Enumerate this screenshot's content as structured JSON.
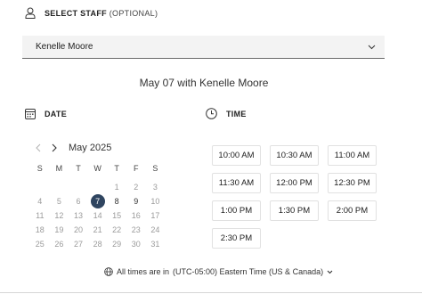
{
  "staff": {
    "label": "SELECT STAFF",
    "optional": "(OPTIONAL)",
    "selected": "Kenelle Moore"
  },
  "summary": "May 07 with Kenelle Moore",
  "date": {
    "label": "DATE",
    "month": "May 2025",
    "weekdays": [
      "S",
      "M",
      "T",
      "W",
      "T",
      "F",
      "S"
    ],
    "weeks": [
      [
        "",
        "",
        "",
        "",
        "1",
        "2",
        "3"
      ],
      [
        "4",
        "5",
        "6",
        "7",
        "8",
        "9",
        "10"
      ],
      [
        "11",
        "12",
        "13",
        "14",
        "15",
        "16",
        "17"
      ],
      [
        "18",
        "19",
        "20",
        "21",
        "22",
        "23",
        "24"
      ],
      [
        "25",
        "26",
        "27",
        "28",
        "29",
        "30",
        "31"
      ]
    ],
    "selected_day": "7"
  },
  "time": {
    "label": "TIME",
    "slots": [
      "10:00 AM",
      "10:30 AM",
      "11:00 AM",
      "11:30 AM",
      "12:00 PM",
      "12:30 PM",
      "1:00 PM",
      "1:30 PM",
      "2:00 PM",
      "2:30 PM"
    ]
  },
  "timezone": {
    "prefix": "All times are in",
    "value": "(UTC-05:00) Eastern Time (US & Canada)"
  },
  "colors": {
    "selected_day_bg": "#2f4560",
    "select_bg": "#f3f3f3"
  }
}
